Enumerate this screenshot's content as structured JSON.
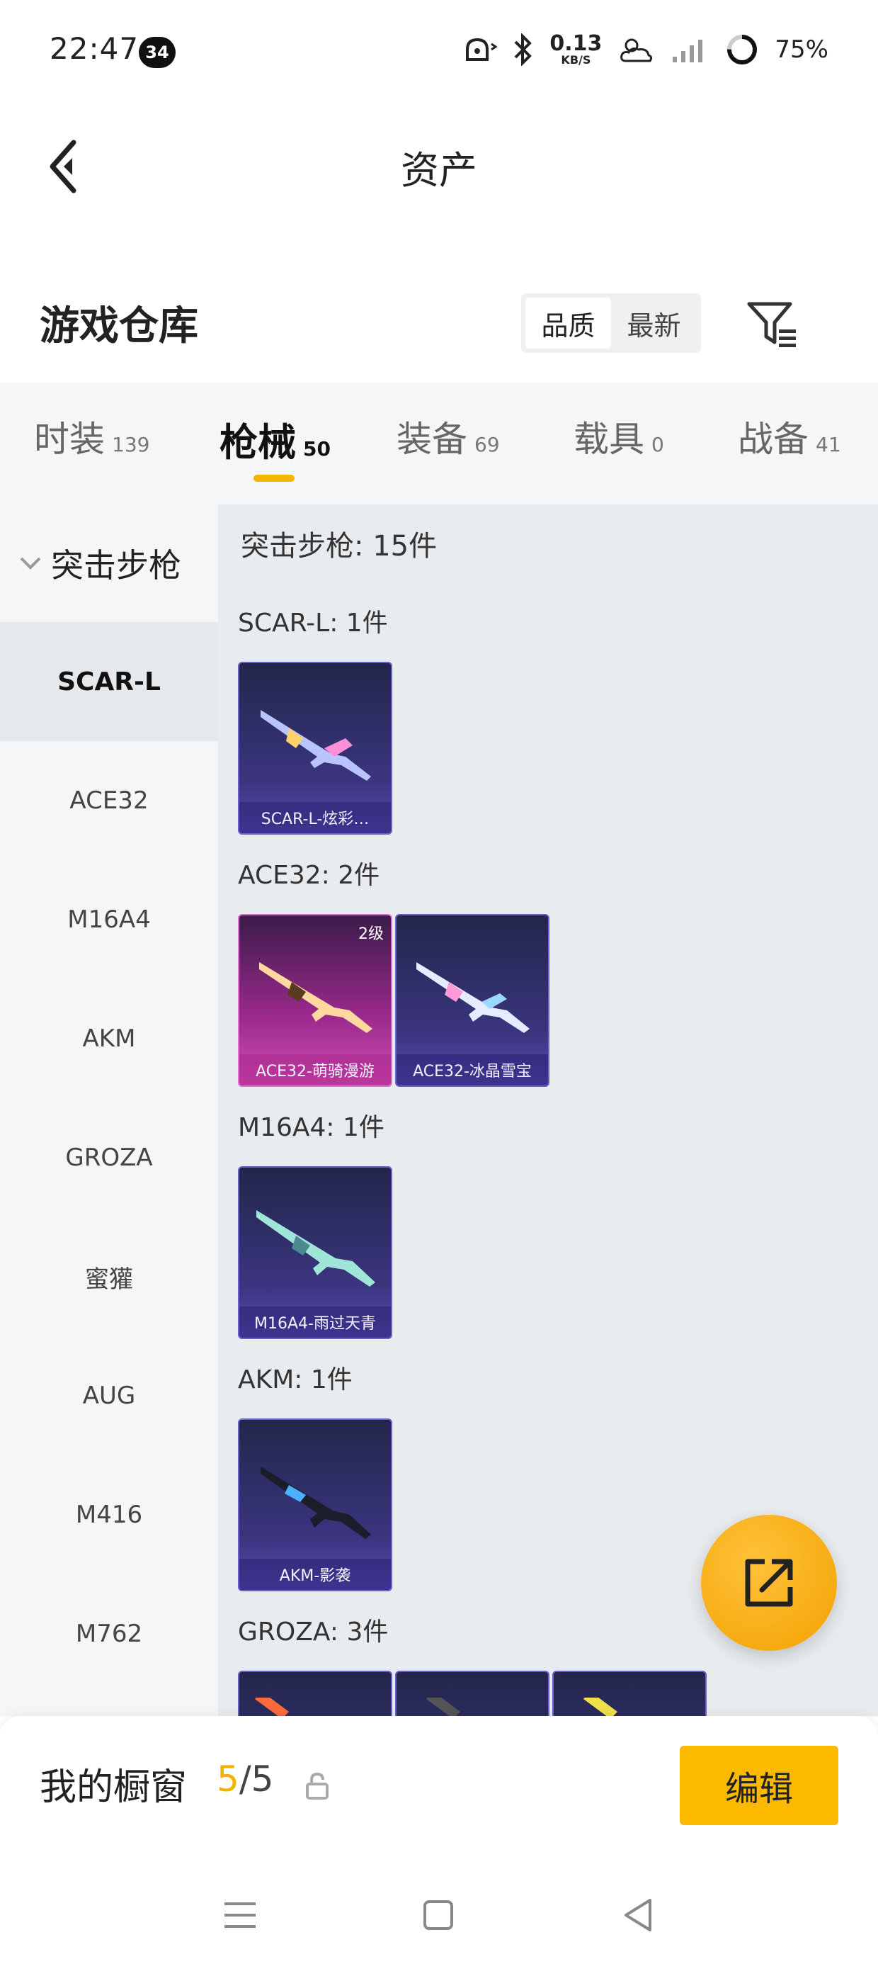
{
  "status_bar": {
    "time": "22:47",
    "notification_count": "34",
    "net_speed_value": "0.13",
    "net_speed_unit": "KB/S",
    "battery": "75%"
  },
  "top_bar": {
    "title": "资产"
  },
  "warehouse": {
    "title": "游戏仓库",
    "sort_options": [
      "品质",
      "最新"
    ],
    "active_sort": "品质"
  },
  "category_tabs": [
    {
      "label": "时装",
      "count": "139"
    },
    {
      "label": "枪械",
      "count": "50"
    },
    {
      "label": "装备",
      "count": "69"
    },
    {
      "label": "载具",
      "count": "0"
    },
    {
      "label": "战备",
      "count": "41"
    }
  ],
  "active_tab": "枪械",
  "side_list": {
    "group": "突击步枪",
    "items": [
      "SCAR-L",
      "ACE32",
      "M16A4",
      "AKM",
      "GROZA",
      "蜜獾",
      "AUG",
      "M416",
      "M762"
    ],
    "active": "SCAR-L"
  },
  "main": {
    "total": "突击步枪: 15件",
    "groups": [
      {
        "label": "SCAR-L: 1件",
        "cards": [
          {
            "name": "SCAR-L-炫彩…",
            "tier": "",
            "style": "purple"
          }
        ]
      },
      {
        "label": "ACE32: 2件",
        "cards": [
          {
            "name": "ACE32-萌骑漫游",
            "tier": "2级",
            "style": "pink"
          },
          {
            "name": "ACE32-冰晶雪宝",
            "tier": "",
            "style": "purple"
          }
        ]
      },
      {
        "label": "M16A4: 1件",
        "cards": [
          {
            "name": "M16A4-雨过天青",
            "tier": "",
            "style": "purple"
          }
        ]
      },
      {
        "label": "AKM: 1件",
        "cards": [
          {
            "name": "AKM-影袭",
            "tier": "",
            "style": "purple"
          }
        ]
      },
      {
        "label": "GROZA: 3件",
        "cards": [
          {
            "name": "",
            "tier": "",
            "style": "purple"
          },
          {
            "name": "",
            "tier": "",
            "style": "purple"
          },
          {
            "name": "",
            "tier": "",
            "style": "purple"
          }
        ]
      }
    ]
  },
  "showcase": {
    "label": "我的橱窗",
    "current": "5",
    "total": "/5",
    "edit_label": "编辑"
  },
  "colors": {
    "accent": "#f5b400",
    "button": "#fbb900",
    "card_purple": "#3b3580",
    "card_pink": "#9b2a8c"
  },
  "icons": [
    "back-arrow-icon",
    "filter-icon",
    "share-export-icon",
    "lock-icon",
    "chevron-down-icon",
    "menu-icon",
    "home-square-icon",
    "back-triangle-icon"
  ]
}
